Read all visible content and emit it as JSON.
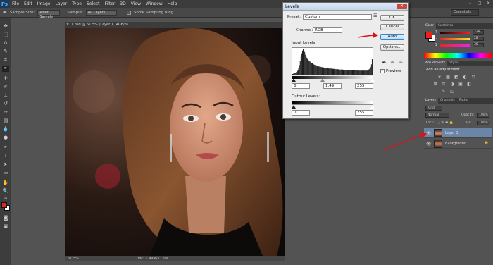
{
  "menubar": {
    "logo": "Ps",
    "items": [
      "File",
      "Edit",
      "Image",
      "Layer",
      "Type",
      "Select",
      "Filter",
      "3D",
      "View",
      "Window",
      "Help"
    ],
    "window_controls": [
      "–",
      "□",
      "✕"
    ]
  },
  "options": {
    "sample_size_label": "Sample Size:",
    "sample_size_value": "Point Sample",
    "sample_label": "Sample:",
    "sample_value": "All Layers",
    "show_ring_label": "Show Sampling Ring",
    "workspace": "Essentials"
  },
  "document": {
    "tab_title": "1.psd @ 61.5% (Layer 1, RGB/8)",
    "zoom": "61.5%",
    "doc_info": "Doc: 1.49M/11.0M"
  },
  "levels": {
    "title": "Levels",
    "close": "✕",
    "preset_label": "Preset:",
    "preset_value": "Custom",
    "channel_label": "Channel:",
    "channel_value": "RGB",
    "input_levels_label": "Input Levels:",
    "input_black": "6",
    "input_gamma": "1.49",
    "input_white": "255",
    "output_levels_label": "Output Levels:",
    "output_black": "0",
    "output_white": "255",
    "buttons": {
      "ok": "OK",
      "cancel": "Cancel",
      "auto": "Auto",
      "options": "Options..."
    },
    "preview_label": "Preview",
    "preview_checked": true,
    "histogram": [
      2,
      3,
      4,
      5,
      6,
      8,
      10,
      14,
      20,
      28,
      40,
      52,
      62,
      70,
      74,
      72,
      66,
      58,
      52,
      48,
      45,
      42,
      40,
      38,
      36,
      34,
      33,
      32,
      30,
      29,
      28,
      27,
      26,
      25,
      24,
      24,
      23,
      23,
      22,
      22,
      21,
      21,
      20,
      20,
      20,
      19,
      19,
      19,
      18,
      18,
      18,
      18,
      17,
      17,
      17,
      17,
      16,
      16,
      16,
      16,
      16,
      15,
      15,
      15,
      15,
      15,
      15,
      14,
      14,
      14,
      14,
      14,
      14,
      14,
      14,
      14,
      13,
      13,
      13,
      13,
      13,
      13,
      13,
      13,
      13,
      13,
      12,
      12,
      12,
      12,
      12,
      12,
      12,
      12,
      12,
      12,
      12,
      12,
      12,
      12,
      14,
      16,
      18,
      22,
      30,
      45
    ]
  },
  "panels": {
    "color_tabs": [
      "Color",
      "Swatches"
    ],
    "color_sliders": [
      {
        "label": "R",
        "value": "238",
        "color": "#ff2020"
      },
      {
        "label": "G",
        "value": "28",
        "color": "#30d030"
      },
      {
        "label": "B",
        "value": "36",
        "color": "#3060ff"
      }
    ],
    "foreground_color": "#e8231f",
    "background_color": "#ffffff",
    "adjust_tabs": [
      "Adjustments",
      "Styles"
    ],
    "adjust_title": "Add an adjustment",
    "adjust_icons": [
      "☀",
      "▦",
      "◩",
      "◐",
      "▽",
      "⊞",
      "⚖",
      "◑",
      "▣",
      "◧",
      "✎",
      "◫"
    ],
    "layers_tabs": [
      "Layers",
      "Channels",
      "Paths"
    ],
    "kind_value": "Kind",
    "blend_mode": "Normal",
    "opacity_label": "Opacity:",
    "opacity_value": "100%",
    "lock_label": "Lock:",
    "fill_label": "Fill:",
    "fill_value": "100%",
    "layers": [
      {
        "name": "Layer 1",
        "selected": true
      },
      {
        "name": "Background",
        "selected": false
      }
    ]
  },
  "colors": {
    "accent_arrow": "#e0101a"
  }
}
